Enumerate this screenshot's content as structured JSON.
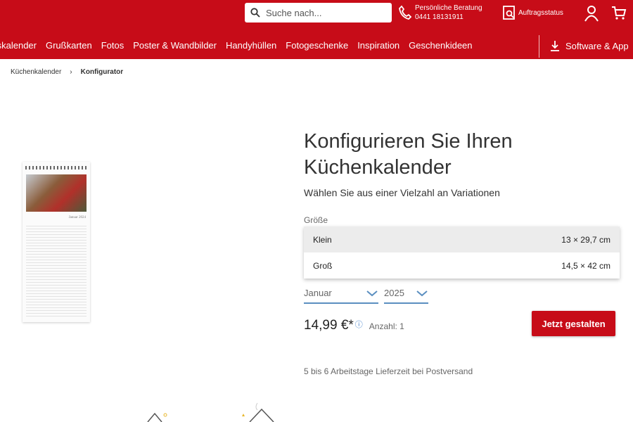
{
  "header": {
    "search_placeholder": "Suche nach...",
    "consult_label": "Persönliche Beratung",
    "consult_phone": "0441 18131911",
    "order_status": "Auftragsstatus",
    "brand_color": "#c70c18"
  },
  "nav": {
    "items": [
      "tskalender",
      "Grußkarten",
      "Fotos",
      "Poster & Wandbilder",
      "Handyhüllen",
      "Fotogeschenke",
      "Inspiration",
      "Geschenkideen"
    ],
    "apps_label": "Software & App"
  },
  "breadcrumb": [
    "Küchenkalender",
    "Konfigurator"
  ],
  "product": {
    "calendar_month": "Januar 2024"
  },
  "config": {
    "title": "Konfigurieren Sie Ihren Küchenkalender",
    "subtitle": "Wählen Sie aus einer Vielzahl an Variationen",
    "size_label": "Größe",
    "size_options": [
      {
        "name": "Klein",
        "dims": "13 × 29,7 cm",
        "selected": true
      },
      {
        "name": "Groß",
        "dims": "14,5 × 42 cm",
        "selected": false
      }
    ],
    "month": "Januar",
    "year": "2025",
    "price": "14,99 €*",
    "quantity": "Anzahl: 1",
    "cta": "Jetzt gestalten",
    "delivery": "5 bis 6 Arbeitstage Lieferzeit bei Postversand"
  }
}
